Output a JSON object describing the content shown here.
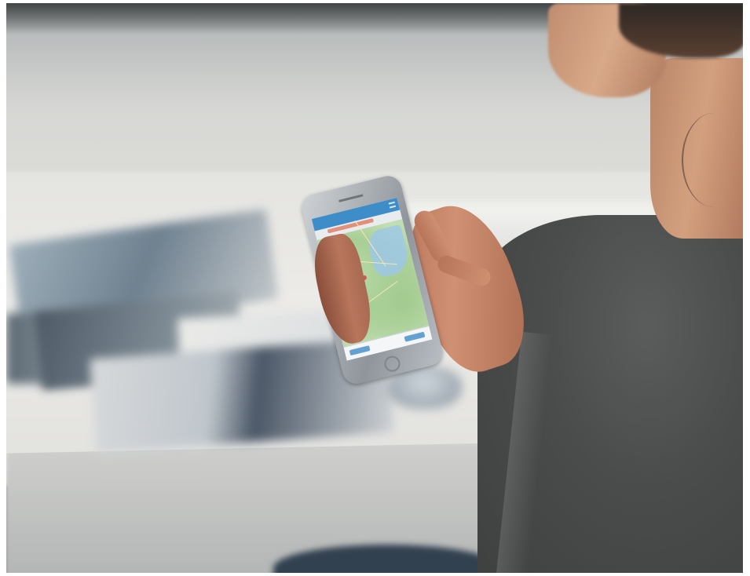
{
  "photo": {
    "subject": "person-holding-smartphone",
    "colors": {
      "app_bar": "#3e8cc8",
      "map_land": "#b4d6a2",
      "map_water": "#9ec8e6",
      "shirt": "#4a4c4c",
      "skin": "#c08c6f",
      "table": "#e4e4e1"
    }
  }
}
